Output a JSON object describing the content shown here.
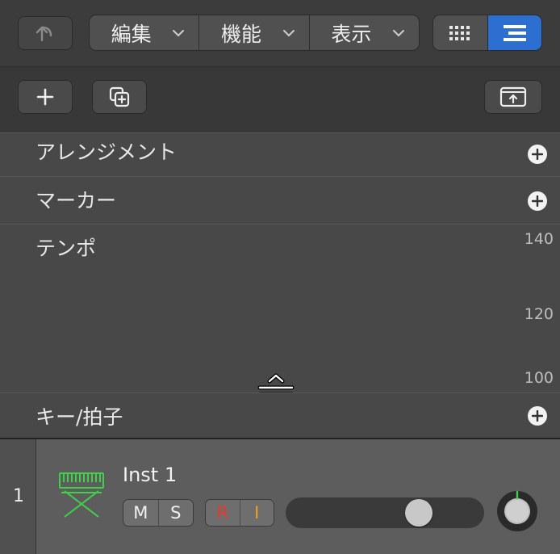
{
  "toolbar": {
    "menus": [
      {
        "label": "編集"
      },
      {
        "label": "機能"
      },
      {
        "label": "表示"
      }
    ],
    "view_mode": "list"
  },
  "global_tracks": [
    {
      "label": "アレンジメント",
      "has_add": true
    },
    {
      "label": "マーカー",
      "has_add": true
    },
    {
      "label": "テンポ",
      "scale": [
        "140",
        "120",
        "100"
      ]
    },
    {
      "label": "キー/拍子",
      "has_add": true
    }
  ],
  "track": {
    "number": "1",
    "name": "Inst 1",
    "mute_label": "M",
    "solo_label": "S",
    "record_label": "R",
    "input_label": "I",
    "volume_level": 0.7,
    "icon": "keyboard-icon"
  },
  "colors": {
    "accent": "#2c6fd1",
    "record": "#e83a2a",
    "input_monitor": "#f0a020",
    "instrument_icon": "#3fd14a"
  }
}
